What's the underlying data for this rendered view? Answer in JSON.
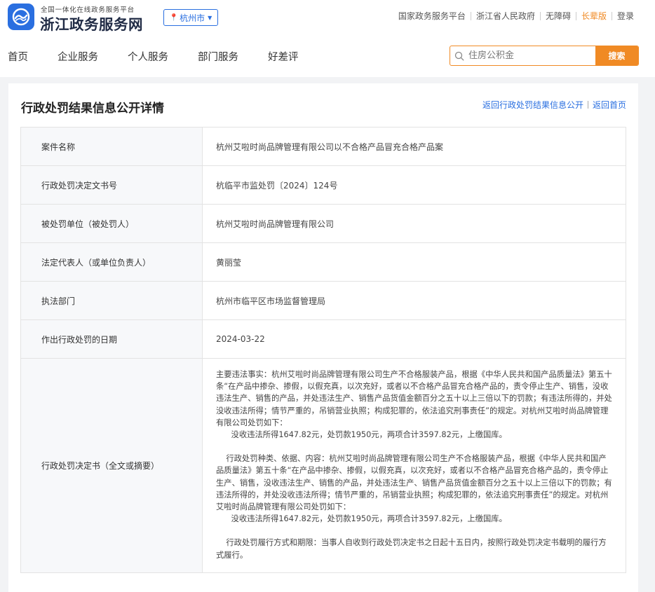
{
  "header": {
    "slogan": "全国一体化在线政务服务平台",
    "site_name": "浙江政务服务网",
    "city": "杭州市",
    "links": [
      "国家政务服务平台",
      "浙江省人民政府",
      "无障碍",
      "长辈版"
    ],
    "login": "登录",
    "nav": [
      "首页",
      "企业服务",
      "个人服务",
      "部门服务",
      "好差评"
    ],
    "search_placeholder": "住房公积金",
    "search_button": "搜索",
    "accent_color": "#f08a24",
    "brand_color": "#2a6fe0"
  },
  "page": {
    "title": "行政处罚结果信息公开详情",
    "back_list": "返回行政处罚结果信息公开",
    "back_home": "返回首页"
  },
  "rows": [
    {
      "label": "案件名称",
      "value": "杭州艾啦时尚品牌管理有限公司以不合格产品冒充合格产品案"
    },
    {
      "label": "行政处罚决定文书号",
      "value": "杭临平市监处罚〔2024〕124号"
    },
    {
      "label": "被处罚单位（被处罚人）",
      "value": "杭州艾啦时尚品牌管理有限公司"
    },
    {
      "label": "法定代表人（或单位负责人）",
      "value": "黄丽莹"
    },
    {
      "label": "执法部门",
      "value": "杭州市临平区市场监督管理局"
    },
    {
      "label": "作出行政处罚的日期",
      "value": "2024-03-22"
    }
  ],
  "decision": {
    "label": "行政处罚决定书（全文或摘要）",
    "paragraphs": [
      "主要违法事实：杭州艾啦时尚品牌管理有限公司生产不合格服装产品，根据《中华人民共和国产品质量法》第五十条“在产品中掺杂、掺假，以假充真，以次充好，或者以不合格产品冒充合格产品的，责令停止生产、销售，没收违法生产、销售的产品，并处违法生产、销售产品货值金额百分之五十以上三倍以下的罚款；有违法所得的，并处没收违法所得；情节严重的，吊销营业执照；构成犯罪的，依法追究刑事责任”的规定。对杭州艾啦时尚品牌管理有限公司处罚如下：\n      没收违法所得1647.82元，处罚款1950元，两项合计3597.82元，上缴国库。",
      "    行政处罚种类、依据、内容：杭州艾啦时尚品牌管理有限公司生产不合格服装产品，根据《中华人民共和国产品质量法》第五十条“在产品中掺杂、掺假，以假充真，以次充好，或者以不合格产品冒充合格产品的，责令停止生产、销售，没收违法生产、销售的产品，并处违法生产、销售产品货值金额百分之五十以上三倍以下的罚款；有违法所得的，并处没收违法所得；情节严重的，吊销营业执照；构成犯罪的，依法追究刑事责任”的规定。对杭州艾啦时尚品牌管理有限公司处罚如下：\n      没收违法所得1647.82元，处罚款1950元，两项合计3597.82元，上缴国库。",
      "    行政处罚履行方式和期限：当事人自收到行政处罚决定书之日起十五日内，按照行政处罚决定书载明的履行方式履行。"
    ]
  }
}
